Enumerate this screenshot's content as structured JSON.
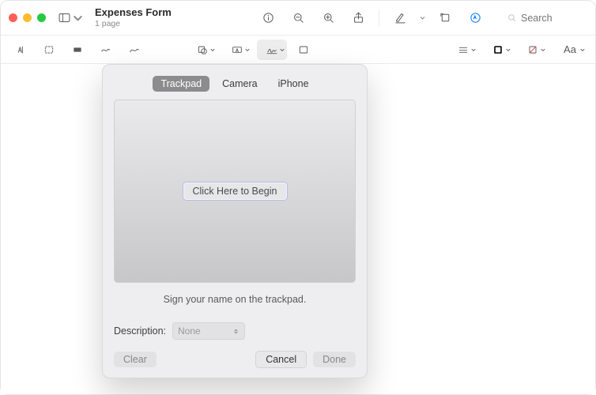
{
  "window": {
    "title": "Expenses Form",
    "subtitle": "1 page"
  },
  "titlebar": {
    "search_placeholder": "Search"
  },
  "signature_popover": {
    "tabs": {
      "trackpad": "Trackpad",
      "camera": "Camera",
      "iphone": "iPhone"
    },
    "begin_label": "Click Here to Begin",
    "hint": "Sign your name on the trackpad.",
    "description_label": "Description:",
    "description_value": "None",
    "buttons": {
      "clear": "Clear",
      "cancel": "Cancel",
      "done": "Done"
    }
  }
}
